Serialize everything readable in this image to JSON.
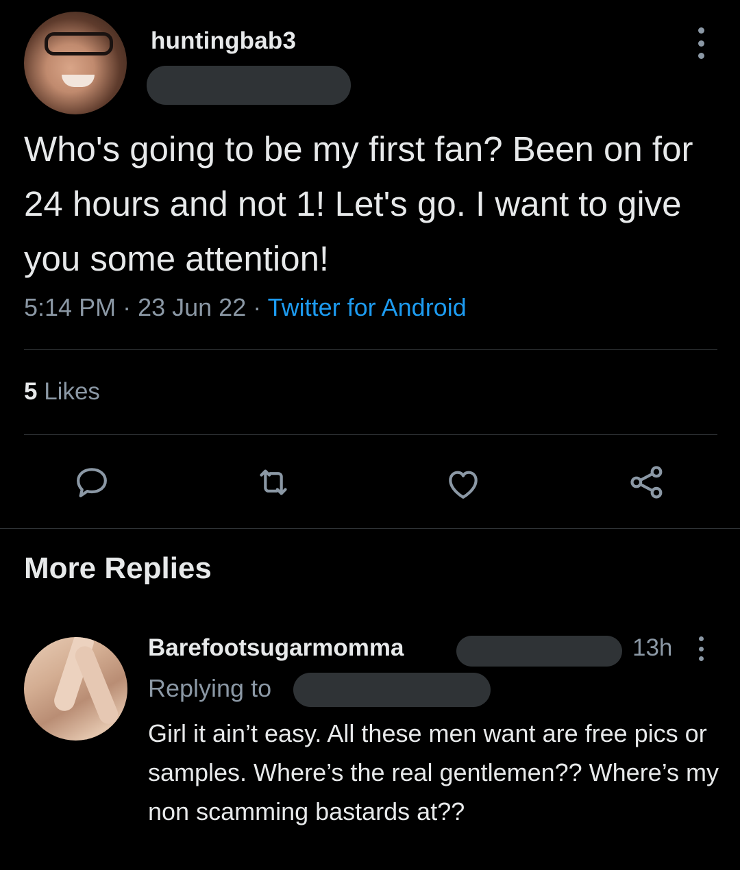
{
  "tweet": {
    "username": "huntingbab3",
    "text": "Who's going to be my first fan? Been on for 24 hours and not 1! Let's go. I want to give you some attention!",
    "time": "5:14 PM",
    "date": "23 Jun 22",
    "source": "Twitter for Android",
    "likes_count": "5",
    "likes_label": "Likes"
  },
  "actions": {
    "icons": [
      "reply-icon",
      "retweet-icon",
      "like-icon",
      "share-icon"
    ]
  },
  "section": {
    "title": "More Replies"
  },
  "reply": {
    "username": "Barefootsugarmomma",
    "time": "13h",
    "replying_to_label": "Replying to",
    "text": "Girl it ain’t easy. All these men want are free pics or samples. Where’s the real gentlemen?? Where’s my non scamming bastards at??"
  },
  "colors": {
    "background": "#000000",
    "text": "#e7e9ea",
    "muted": "#8b98a5",
    "accent": "#1d9bf0",
    "divider": "#2f3336"
  }
}
